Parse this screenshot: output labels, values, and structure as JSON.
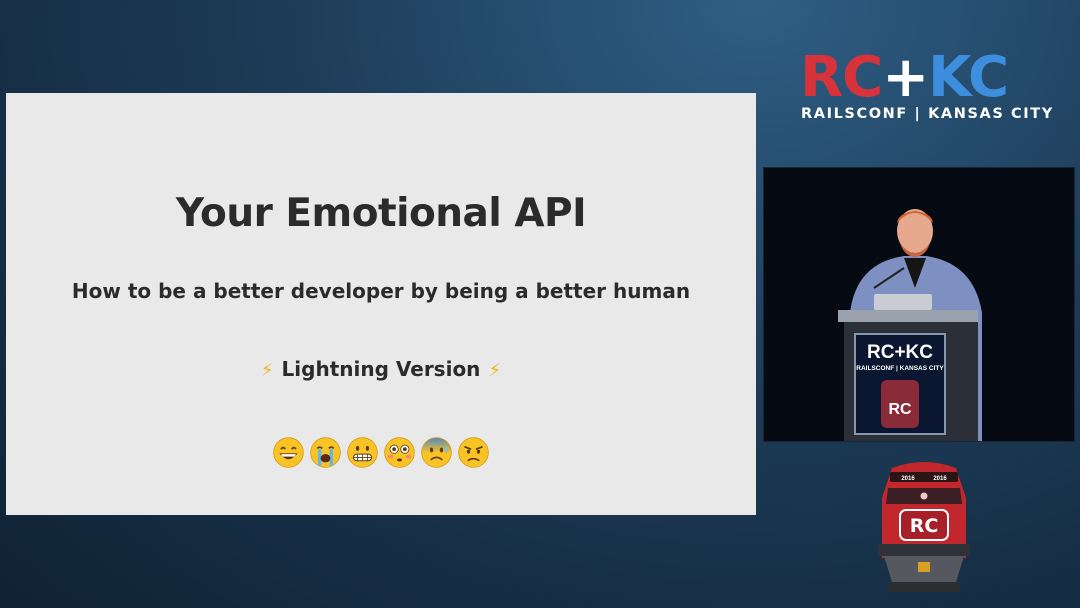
{
  "slide": {
    "title": "Your Emotional API",
    "subtitle": "How to be a better developer by being a better human",
    "version_label": "Lightning Version",
    "emojis": [
      "grinning-face",
      "crying-face",
      "grimacing-face",
      "flushed-face",
      "anxious-sweat-face",
      "angry-face"
    ]
  },
  "logo": {
    "rc": "RC",
    "plus": "+",
    "kc": "KC",
    "tagline": "RAILSCONF | KANSAS CITY"
  },
  "video": {
    "podium_logo": "RC+KC",
    "podium_tagline": "RAILSCONF | KANSAS CITY",
    "podium_badge": "RC"
  },
  "train_badge": {
    "label": "RC",
    "year_left": "2016",
    "year_right": "2016"
  },
  "colors": {
    "rc_red": "#d8323a",
    "kc_blue": "#3e8ede",
    "slide_bg": "#e9e9e9",
    "bolt": "#f2b61f"
  }
}
